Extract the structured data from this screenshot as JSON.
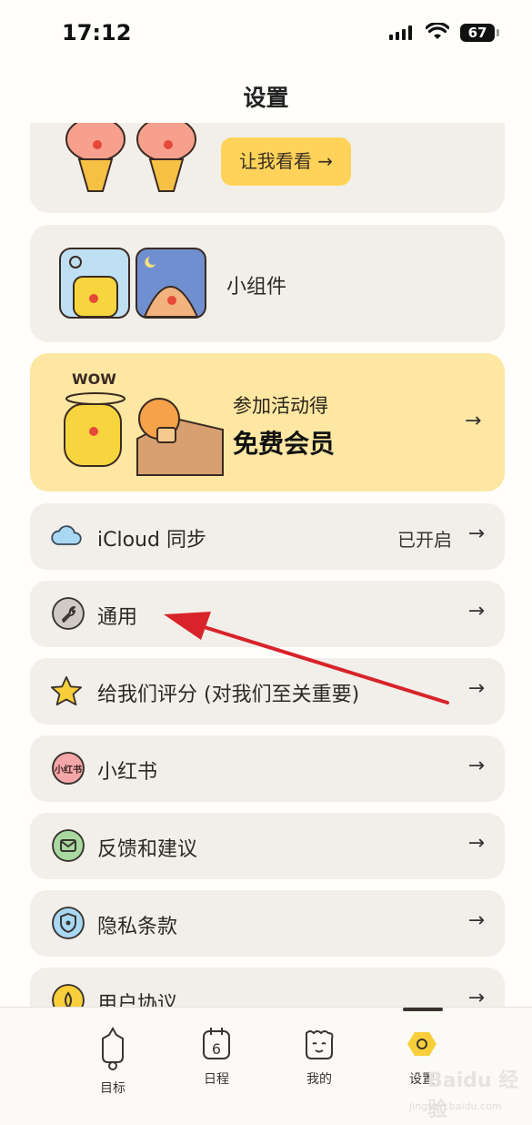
{
  "status_bar": {
    "time": "17:12",
    "battery": "67"
  },
  "header": {
    "title": "设置"
  },
  "promo": {
    "button_label": "让我看看 →"
  },
  "widget": {
    "label": "小组件"
  },
  "event": {
    "line1": "参加活动得",
    "line2": "免费会员",
    "arrow": "→"
  },
  "settings": [
    {
      "label": "iCloud 同步",
      "value": "已开启",
      "icon": "cloud-icon"
    },
    {
      "label": "通用",
      "icon": "wrench-icon"
    },
    {
      "label": "给我们评分 (对我们至关重要)",
      "icon": "star-icon"
    },
    {
      "label": "小红书",
      "icon": "xiaohongshu-icon",
      "icon_text": "小红书"
    },
    {
      "label": "反馈和建议",
      "icon": "mail-icon"
    },
    {
      "label": "隐私条款",
      "icon": "privacy-shield-icon"
    },
    {
      "label": "用户协议",
      "icon": "agreement-icon"
    }
  ],
  "arrow_glyph": "→",
  "tabs": [
    {
      "label": "目标",
      "icon": "target-icon"
    },
    {
      "label": "日程",
      "icon": "calendar-icon",
      "icon_text": "6"
    },
    {
      "label": "我的",
      "icon": "face-icon"
    },
    {
      "label": "设置",
      "icon": "settings-icon",
      "selected": true
    }
  ],
  "watermark": {
    "text": "Baidu 经验",
    "sub": "jingyan.baidu.com"
  },
  "colors": {
    "accent": "#ffd35a",
    "card": "#f2efea",
    "event_bg": "#fde7a2",
    "annotation": "#d8232a"
  }
}
